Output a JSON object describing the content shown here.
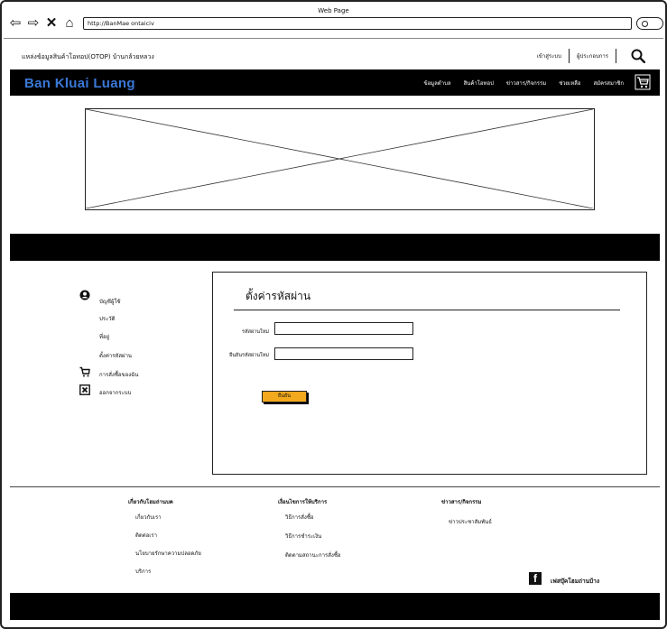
{
  "browser": {
    "window_title": "Web Page",
    "url": "http://BanMae ontaiciv"
  },
  "topbar": {
    "site_title": "แหล่งข้อมูลสินค้าโอทอป(OTOP) บ้านกล้วยหลวง",
    "login": "เข้าสู่ระบบ",
    "register": "ผู้ประกอบการ"
  },
  "header": {
    "brand": "Ban Kluai Luang",
    "menu": [
      "ข้อมูลตำบล",
      "สินค้าโอทอป",
      "ข่าวสาร/กิจกรรม",
      "ช่วยเหลือ",
      "สมัครสมาชิก"
    ]
  },
  "sidebar": {
    "items": [
      {
        "label": "บัญชีผู้ใช้",
        "icon": "user-circle-icon"
      },
      {
        "label": "ประวัติ",
        "icon": ""
      },
      {
        "label": "ที่อยู่",
        "icon": ""
      },
      {
        "label": "ตั้งค่ารหัสผ่าน",
        "icon": ""
      },
      {
        "label": "การสั่งซื้อของฉัน",
        "icon": "cart-icon"
      },
      {
        "label": "ออกจากระบบ",
        "icon": "close-box-icon"
      }
    ]
  },
  "form": {
    "title": "ตั้งค่ารหัสผ่าน",
    "new_password_label": "รหัสผ่านใหม่",
    "confirm_password_label": "ยืนยันรหัสผ่านใหม่",
    "new_password_value": "",
    "confirm_password_value": "",
    "submit_label": "ยืนยัน"
  },
  "footer": {
    "col1": {
      "heading": "เกี่ยวกับโฮมถ่านบค",
      "items": [
        "เกี่ยวกับเรา",
        "ติดต่อเรา",
        "นโยบายรักษาความปลอดภัย",
        "บริการ"
      ]
    },
    "col2": {
      "heading": "เงื่อนไขการให้บริการ",
      "items": [
        "วิธีการสั่งซื้อ",
        "วิธีการชำระเงิน",
        "ติดตามสถานะการสั่งซื้อ"
      ]
    },
    "col3": {
      "heading": "ข่าวสาร/กิจกรรม",
      "items": [
        "ข่าวประชาสัมพันธ์"
      ]
    },
    "facebook_label": "เฟสบุ๊คโฮมถ่านบ้าง"
  },
  "colors": {
    "brand": "#3a78d6",
    "button": "#f3a91d",
    "bars": "#000000"
  }
}
